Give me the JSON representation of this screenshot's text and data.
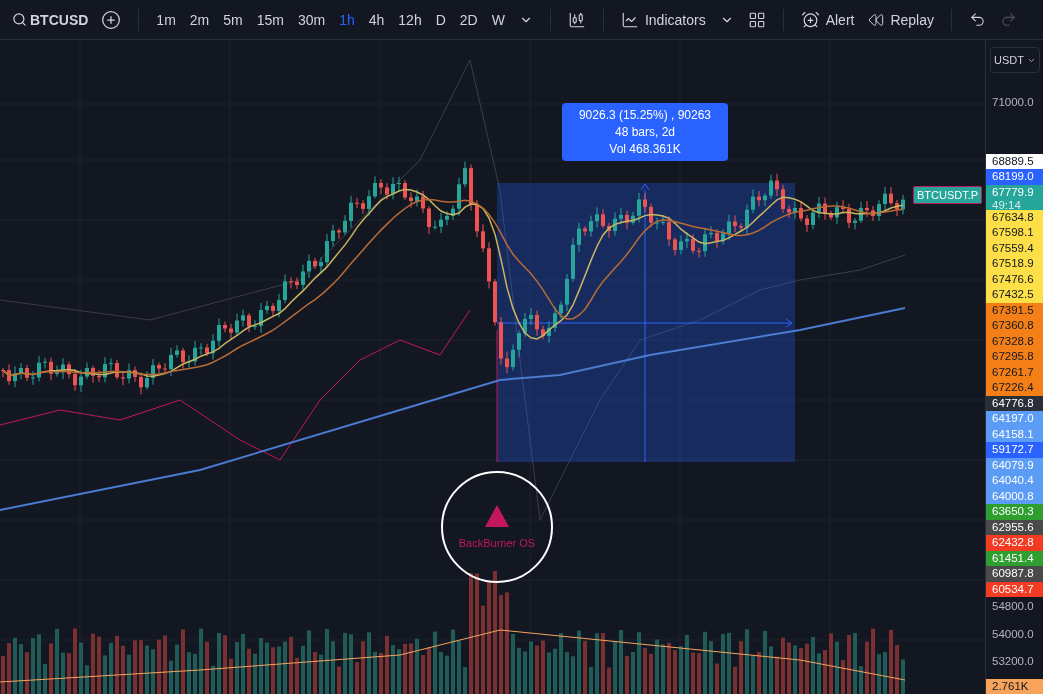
{
  "toolbar": {
    "symbol": "BTCUSD",
    "intervals": [
      {
        "label": "1m",
        "selected": false
      },
      {
        "label": "2m",
        "selected": false
      },
      {
        "label": "5m",
        "selected": false
      },
      {
        "label": "15m",
        "selected": false
      },
      {
        "label": "30m",
        "selected": false
      },
      {
        "label": "1h",
        "selected": true
      },
      {
        "label": "4h",
        "selected": false
      },
      {
        "label": "12h",
        "selected": false
      },
      {
        "label": "D",
        "selected": false
      },
      {
        "label": "2D",
        "selected": false
      },
      {
        "label": "W",
        "selected": false
      }
    ],
    "indicators_label": "Indicators",
    "alert_label": "Alert",
    "replay_label": "Replay",
    "redo_disabled": true
  },
  "chart": {
    "measure": {
      "lines": [
        "9026.3 (15.25%) , 90263",
        "48 bars, 2d",
        "Vol 468.361K"
      ]
    },
    "symbol_tag": {
      "text": "BTCUSDT.P",
      "color": "#26a69a"
    },
    "marker": {
      "label": "BackBurner OS"
    }
  },
  "price_axis": {
    "currency": "USDT",
    "top_ticks": [
      "71000.0"
    ],
    "badges": [
      {
        "text": "68889.5",
        "color": "#ffffff"
      },
      {
        "text": "68199.0",
        "color": "#2962ff"
      },
      {
        "text": "67779.9",
        "sub": "49:14",
        "color": "#26a69a"
      },
      {
        "text": "67634.8",
        "color": "#fde047"
      },
      {
        "text": "67598.1",
        "color": "#fde047"
      },
      {
        "text": "67559.4",
        "color": "#fde047"
      },
      {
        "text": "67518.9",
        "color": "#fde047"
      },
      {
        "text": "67476.6",
        "color": "#fde047"
      },
      {
        "text": "67432.5",
        "color": "#fde047"
      },
      {
        "text": "67391.5",
        "color": "#f57f17"
      },
      {
        "text": "67360.8",
        "color": "#f57f17"
      },
      {
        "text": "67328.8",
        "color": "#f57f17"
      },
      {
        "text": "67295.8",
        "color": "#f57f17"
      },
      {
        "text": "67261.7",
        "color": "#f57f17"
      },
      {
        "text": "67226.4",
        "color": "#f57f17"
      },
      {
        "text": "64776.8",
        "color": "#2a2e39"
      },
      {
        "text": "64197.0",
        "color": "#5b9cf6"
      },
      {
        "text": "64158.1",
        "color": "#5b9cf6"
      },
      {
        "text": "59172.7",
        "color": "#2962ff"
      },
      {
        "text": "64079.9",
        "color": "#5b9cf6"
      },
      {
        "text": "64040.4",
        "color": "#5b9cf6"
      },
      {
        "text": "64000.8",
        "color": "#5b9cf6"
      },
      {
        "text": "63650.3",
        "color": "#2e9e2e"
      },
      {
        "text": "62955.6",
        "color": "#4a4a4a"
      },
      {
        "text": "62432.8",
        "color": "#f23b22"
      },
      {
        "text": "61451.4",
        "color": "#2e9e2e"
      },
      {
        "text": "60987.8",
        "color": "#4a4a4a"
      },
      {
        "text": "60534.7",
        "color": "#f23b22"
      }
    ],
    "bottom_ticks": [
      "54800.0",
      "54000.0",
      "53200.0"
    ],
    "volume_label": {
      "text": "2.761K",
      "color": "#f7a35c"
    }
  }
}
